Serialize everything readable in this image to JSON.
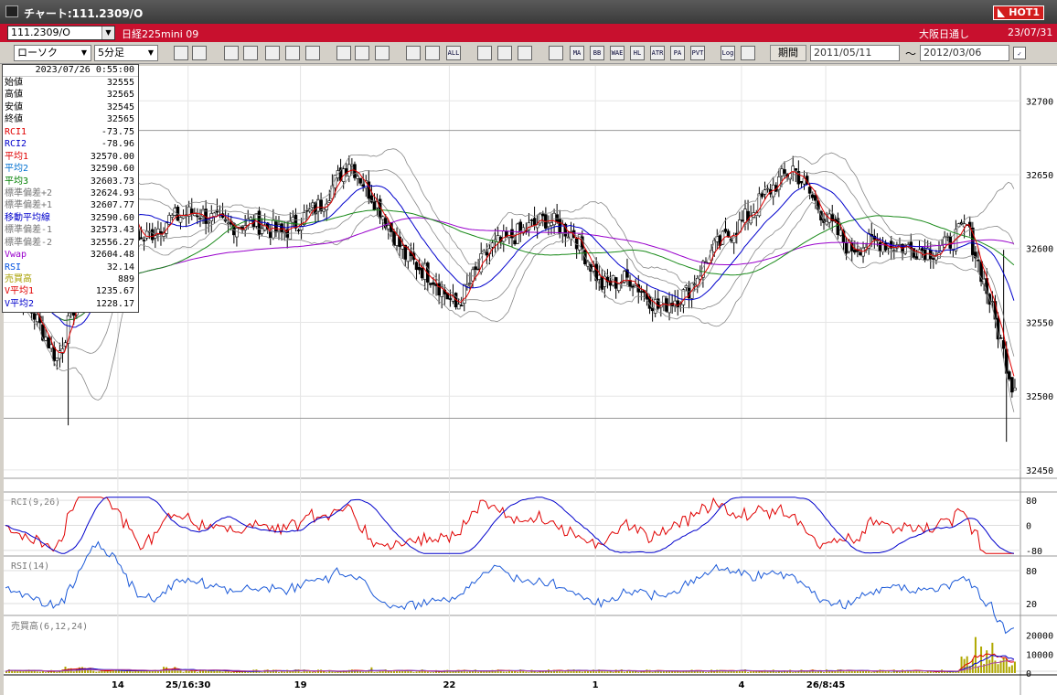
{
  "window": {
    "title": "チャート:111.2309/O",
    "hot_badge": "HOT1"
  },
  "instrument_bar": {
    "code": "111.2309/O",
    "name": "日経225mini 09",
    "market": "大阪日通し",
    "date": "23/07/31"
  },
  "toolbar": {
    "chart_type": "ローソク",
    "interval": "5分足",
    "icons": [
      "zoom-icon",
      "crosshair-icon",
      "draw-down-icon",
      "search-chart-icon",
      "bar-chart-icon",
      "swap-icon",
      "info-icon",
      "pen-icon",
      "cursor-icon",
      "redo-icon",
      "candle-add-icon",
      "candle-remove-icon",
      "all-icon",
      "settings-icon",
      "brush-icon",
      "palette-icon",
      "indicator-icon",
      "ma-icon",
      "bb-icon",
      "wae-icon",
      "hl-icon",
      "atr-icon",
      "pa-rr-icon",
      "pvt-icon",
      "log-icon",
      "export-icon"
    ],
    "icon_labels": [
      "",
      "",
      "",
      "",
      "",
      "",
      "",
      "",
      "",
      "",
      "",
      "",
      "ALL",
      "",
      "",
      "",
      "",
      "MA",
      "BB",
      "WAE",
      "HL",
      "ATR",
      "PA RR",
      "PVT",
      "Log",
      ""
    ],
    "period_button": "期間",
    "date_from": "2011/05/11",
    "date_to": "2012/03/06",
    "tilde": "〜"
  },
  "data_window": {
    "datetime": "2023/07/26  0:55:00",
    "rows": [
      {
        "label": "始値",
        "value": "32555",
        "color": "#000000"
      },
      {
        "label": "高値",
        "value": "32565",
        "color": "#000000"
      },
      {
        "label": "安値",
        "value": "32545",
        "color": "#000000"
      },
      {
        "label": "終値",
        "value": "32565",
        "color": "#000000"
      },
      {
        "label": "RCI1",
        "value": "-73.75",
        "color": "#e00000"
      },
      {
        "label": "RCI2",
        "value": "-78.96",
        "color": "#0000cc"
      },
      {
        "label": "平均1",
        "value": "32570.00",
        "color": "#e00000"
      },
      {
        "label": "平均2",
        "value": "32590.60",
        "color": "#0070d0"
      },
      {
        "label": "平均3",
        "value": "32603.73",
        "color": "#008000"
      },
      {
        "label": "標準偏差+2",
        "value": "32624.93",
        "color": "#777777"
      },
      {
        "label": "標準偏差+1",
        "value": "32607.77",
        "color": "#777777"
      },
      {
        "label": "移動平均線",
        "value": "32590.60",
        "color": "#0000cc"
      },
      {
        "label": "標準偏差-1",
        "value": "32573.43",
        "color": "#777777"
      },
      {
        "label": "標準偏差-2",
        "value": "32556.27",
        "color": "#777777"
      },
      {
        "label": "Vwap",
        "value": "32604.48",
        "color": "#9900cc"
      },
      {
        "label": "RSI",
        "value": "32.14",
        "color": "#0050e0"
      },
      {
        "label": "売買高",
        "value": "889",
        "color": "#a8a000"
      },
      {
        "label": "V平均1",
        "value": "1235.67",
        "color": "#e00000"
      },
      {
        "label": "V平均2",
        "value": "1228.17",
        "color": "#0000cc"
      }
    ]
  },
  "chart_data": [
    {
      "type": "candlestick",
      "panel": "price",
      "y_ticks": [
        32450,
        32500,
        32550,
        32600,
        32650,
        32700
      ],
      "ylim": [
        32445,
        32720
      ],
      "x_ticks": [
        "14",
        "25/16:30",
        "19",
        "22",
        "1",
        "4",
        "26/8:45"
      ],
      "horizontal_lines": [
        32680,
        32485
      ],
      "waypoints": [
        [
          0,
          32580
        ],
        [
          10,
          32555
        ],
        [
          18,
          32525
        ],
        [
          24,
          32560
        ],
        [
          30,
          32615
        ],
        [
          40,
          32640
        ],
        [
          48,
          32605
        ],
        [
          58,
          32620
        ],
        [
          68,
          32625
        ],
        [
          78,
          32615
        ],
        [
          88,
          32618
        ],
        [
          98,
          32610
        ],
        [
          112,
          32630
        ],
        [
          122,
          32660
        ],
        [
          132,
          32630
        ],
        [
          142,
          32595
        ],
        [
          152,
          32580
        ],
        [
          160,
          32560
        ],
        [
          172,
          32600
        ],
        [
          182,
          32610
        ],
        [
          192,
          32620
        ],
        [
          202,
          32610
        ],
        [
          212,
          32575
        ],
        [
          222,
          32580
        ],
        [
          232,
          32560
        ],
        [
          242,
          32570
        ],
        [
          252,
          32600
        ],
        [
          262,
          32618
        ],
        [
          272,
          32640
        ],
        [
          280,
          32655
        ],
        [
          290,
          32625
        ],
        [
          300,
          32600
        ],
        [
          310,
          32605
        ],
        [
          322,
          32600
        ],
        [
          332,
          32598
        ],
        [
          342,
          32615
        ],
        [
          350,
          32565
        ],
        [
          358,
          32508
        ]
      ],
      "n_candles": 360
    },
    {
      "type": "line",
      "panel": "rci",
      "title": "RCI(9,26)",
      "y_ticks": [
        80,
        0,
        -80
      ],
      "ylim": [
        -95,
        95
      ]
    },
    {
      "type": "line",
      "panel": "rsi",
      "title": "RSI(14)",
      "y_ticks": [
        80,
        20
      ],
      "ylim": [
        0,
        100
      ]
    },
    {
      "type": "bar",
      "panel": "volume",
      "title": "売買高(6,12,24)",
      "y_ticks": [
        20000,
        10000,
        0
      ],
      "ylim": [
        0,
        28000
      ]
    }
  ]
}
